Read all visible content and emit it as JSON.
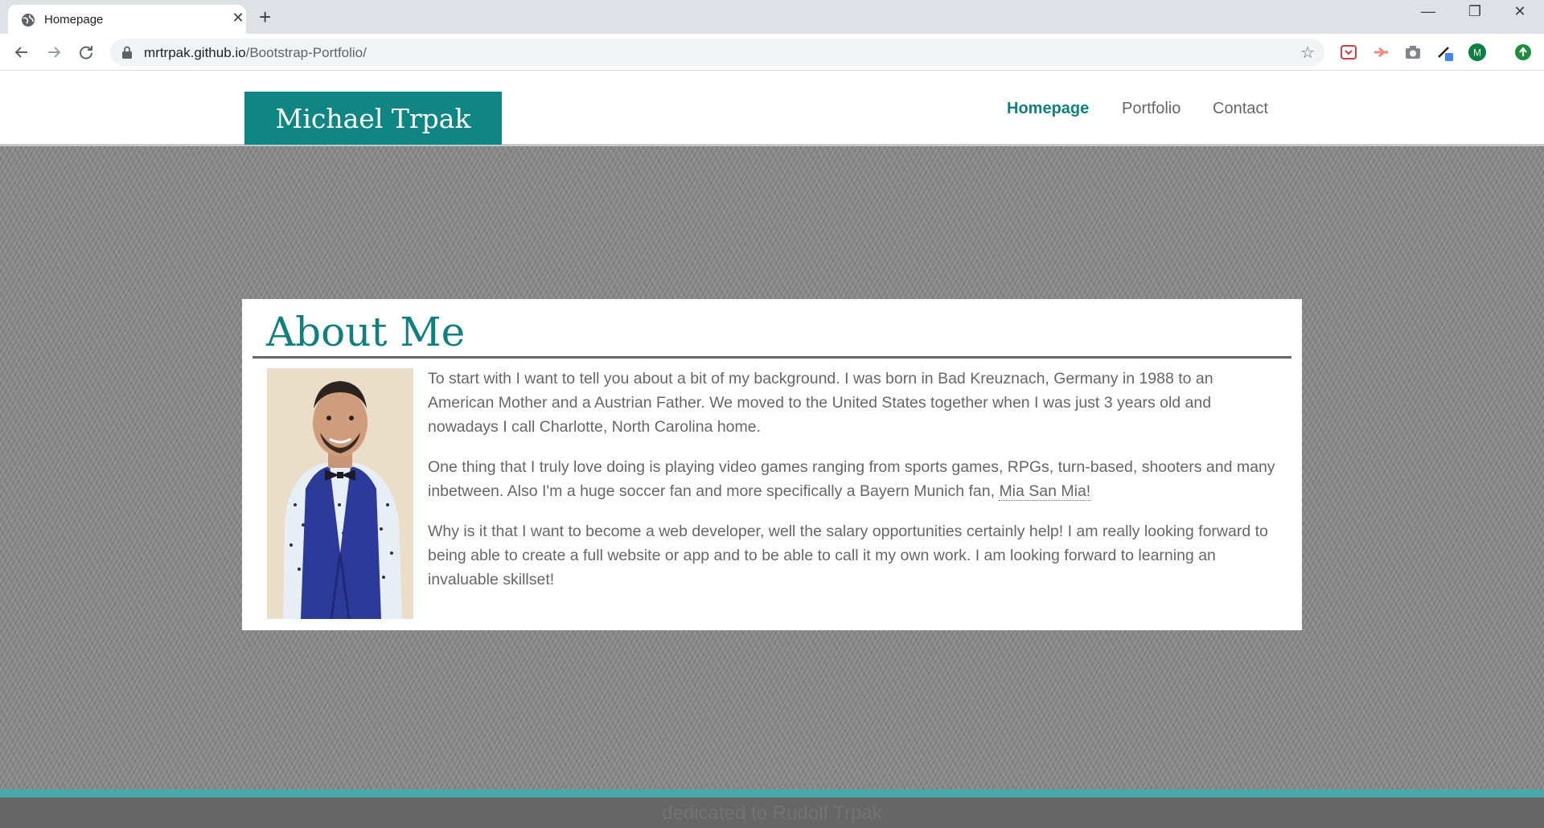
{
  "browser": {
    "tab_title": "Homepage",
    "tab_close": "✕",
    "new_tab": "+",
    "url_host": "mrtrpak.github.io",
    "url_path": "/Bootstrap-Portfolio/",
    "window_controls": {
      "minimize": "—",
      "restore": "❐",
      "close": "✕"
    },
    "profile_initial": "M"
  },
  "site": {
    "brand": "Michael Trpak",
    "nav": [
      {
        "label": "Homepage",
        "active": true
      },
      {
        "label": "Portfolio",
        "active": false
      },
      {
        "label": "Contact",
        "active": false
      }
    ]
  },
  "about": {
    "heading": "About Me",
    "paragraphs": [
      "To start with I want to tell you about a bit of my background. I was born in Bad Kreuznach, Germany in 1988 to an American Mother and a Austrian Father. We moved to the United States together when I was just 3 years old and nowadays I call Charlotte, North Carolina home.",
      "One thing that I truly love doing is playing video games ranging from sports games, RPGs, turn-based, shooters and many inbetween. Also I'm a huge soccer fan and more specifically a Bayern Munich fan, ",
      "Why is it that I want to become a web developer, well the salary opportunities certainly help! I am really looking forward to being able to create a full website or app and to be able to call it my own work. I am looking forward to learning an invaluable skillset!"
    ],
    "link_text": "Mia San Mia!"
  },
  "footer": {
    "text": "dedicated to Rudolf Trpak"
  },
  "colors": {
    "accent": "#0f8584",
    "footer_stripe": "#4aa9a9",
    "footer_bg": "#666666",
    "page_bg": "#8a8a8a"
  }
}
